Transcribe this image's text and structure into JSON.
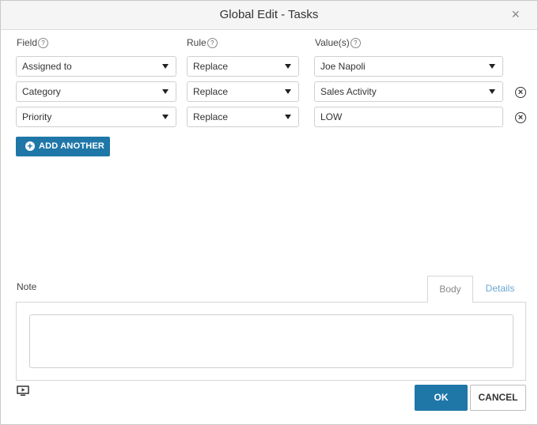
{
  "dialog": {
    "title": "Global Edit - Tasks",
    "close_glyph": "×"
  },
  "columns": {
    "field": "Field",
    "rule": "Rule",
    "values": "Value(s)",
    "help_glyph": "?"
  },
  "rows": [
    {
      "field": "Assigned to",
      "rule": "Replace",
      "value": "Joe Napoli",
      "value_type": "dropdown",
      "removable": false
    },
    {
      "field": "Category",
      "rule": "Replace",
      "value": "Sales Activity",
      "value_type": "dropdown",
      "removable": true
    },
    {
      "field": "Priority",
      "rule": "Replace",
      "value": "LOW",
      "value_type": "text",
      "removable": true
    }
  ],
  "add_another": {
    "label": "ADD ANOTHER",
    "icon": "plus-circle-icon"
  },
  "note": {
    "label": "Note",
    "tabs": [
      "Body",
      "Details"
    ],
    "active_tab": "Body",
    "body_value": ""
  },
  "footer": {
    "ok_label": "OK",
    "cancel_label": "CANCEL",
    "preview_icon": "screen-play-icon"
  },
  "colors": {
    "primary": "#1f77a8",
    "link": "#6aa6d1",
    "titlebar": "#f5f5f5"
  }
}
